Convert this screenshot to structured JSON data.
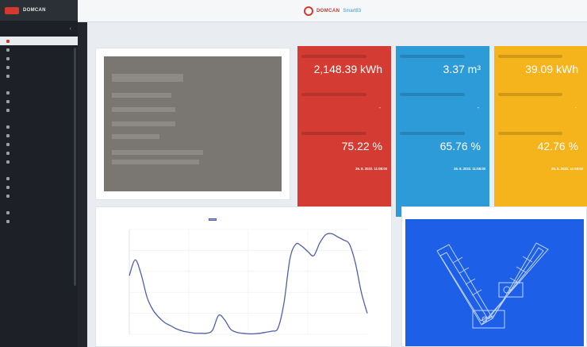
{
  "sidebar": {
    "logo_text": "DOMCAN",
    "sections": [
      {
        "title": "",
        "items": [
          {
            "label": "",
            "active": true
          },
          {
            "label": "",
            "active": false
          },
          {
            "label": "",
            "active": false
          },
          {
            "label": "",
            "active": false
          },
          {
            "label": "",
            "active": false
          }
        ]
      },
      {
        "title": "",
        "items": [
          {
            "label": "",
            "active": false
          },
          {
            "label": "",
            "active": false
          },
          {
            "label": "",
            "active": false
          }
        ]
      },
      {
        "title": "",
        "items": [
          {
            "label": "",
            "active": false
          },
          {
            "label": "",
            "active": false
          },
          {
            "label": "",
            "active": false
          },
          {
            "label": "",
            "active": false
          },
          {
            "label": "",
            "active": false
          }
        ]
      },
      {
        "title": "",
        "items": [
          {
            "label": "",
            "active": false
          },
          {
            "label": "",
            "active": false
          },
          {
            "label": "",
            "active": false
          }
        ]
      },
      {
        "title": "",
        "items": [
          {
            "label": "",
            "active": false
          },
          {
            "label": "",
            "active": false
          }
        ]
      }
    ]
  },
  "topbar": {
    "brand": "DOMCAN",
    "brand_suffix": "Smart83"
  },
  "metrics": [
    {
      "color": "#d43c33",
      "title": "",
      "label1": "",
      "value": "2,148.39 kWh",
      "label2": "",
      "dash": "-",
      "label3": "",
      "percent": "75.22 %",
      "date_label": "",
      "date": "26. 8. 2022. 11:08:00"
    },
    {
      "color": "#2d9bd8",
      "title": "",
      "label1": "",
      "value": "3.37 m³",
      "label2": "",
      "dash": "-",
      "label3": "",
      "percent": "65.76 %",
      "date_label": "",
      "date": "26. 8. 2022. 11:08:00"
    },
    {
      "color": "#f5b41c",
      "title": "",
      "label1": "",
      "value": "39.09 kWh",
      "label2": "",
      "dash": "-",
      "label3": "",
      "percent": "42.76 %",
      "date_label": "",
      "date": "26. 8. 2022. 11:08:00"
    }
  ],
  "chart": {
    "title": "",
    "legend": ""
  },
  "plan": {
    "title": ""
  },
  "icons": {
    "logo": "logo-icon",
    "toggle": "hamburger-icon"
  },
  "chart_data": {
    "type": "line",
    "title": "",
    "xlabel": "",
    "ylabel": "",
    "ylim": [
      0,
      10
    ],
    "x": [
      0,
      1,
      2,
      3,
      4,
      5,
      6,
      7,
      8,
      9,
      10,
      11,
      12,
      13,
      14,
      15,
      16,
      17,
      18,
      19,
      20,
      21,
      22,
      23,
      24,
      25,
      26,
      27,
      28,
      29,
      30,
      31,
      32,
      33,
      34,
      35,
      36,
      37,
      38,
      39,
      40
    ],
    "series": [
      {
        "name": "",
        "values": [
          5.6,
          7.1,
          5.7,
          3.5,
          2.3,
          1.6,
          1.1,
          0.8,
          0.5,
          0.3,
          0.2,
          0.1,
          0.1,
          0.1,
          0.4,
          1.8,
          1.4,
          0.5,
          0.2,
          0.1,
          0.05,
          0.05,
          0.1,
          0.2,
          0.3,
          0.6,
          3.0,
          7.2,
          8.6,
          8.4,
          7.9,
          7.5,
          8.7,
          9.5,
          9.6,
          9.3,
          9.0,
          8.6,
          6.8,
          4.0,
          2.0
        ]
      }
    ]
  }
}
